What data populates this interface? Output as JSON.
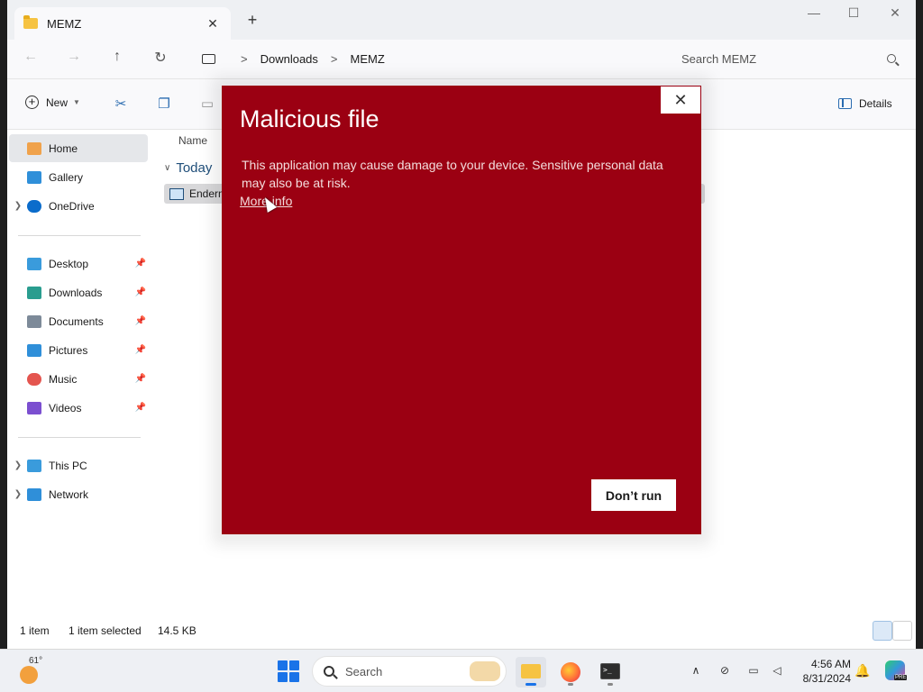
{
  "window": {
    "tab_title": "MEMZ",
    "tab_close": "✕",
    "new_tab": "+",
    "controls": {
      "minimize": "—",
      "maximize": "☐",
      "close": "✕"
    }
  },
  "address": {
    "breadcrumb": [
      "Downloads",
      "MEMZ"
    ],
    "separator": ">",
    "search_placeholder": "Search MEMZ"
  },
  "toolbar": {
    "new_label": "New",
    "details_label": "Details",
    "icons": [
      "cut-icon",
      "copy-icon",
      "paste-icon"
    ]
  },
  "sidebar": {
    "items": [
      {
        "label": "Home",
        "icon": "home-icon",
        "color": "#f0a24b"
      },
      {
        "label": "Gallery",
        "icon": "gallery-icon",
        "color": "#2f8fd9"
      },
      {
        "label": "OneDrive",
        "icon": "onedrive-icon",
        "color": "#0b6ccb"
      },
      {
        "label": "Desktop",
        "icon": "desktop-icon",
        "color": "#3a9bdc"
      },
      {
        "label": "Downloads",
        "icon": "downloads-icon",
        "color": "#2a9d8f"
      },
      {
        "label": "Documents",
        "icon": "documents-icon",
        "color": "#7d8a99"
      },
      {
        "label": "Pictures",
        "icon": "pictures-icon",
        "color": "#2f8fd9"
      },
      {
        "label": "Music",
        "icon": "music-icon",
        "color": "#e4554f"
      },
      {
        "label": "Videos",
        "icon": "videos-icon",
        "color": "#7b4fd0"
      },
      {
        "label": "This PC",
        "icon": "this-pc-icon",
        "color": "#3a9bdc"
      },
      {
        "label": "Network",
        "icon": "network-icon",
        "color": "#2f8fd9"
      }
    ]
  },
  "content": {
    "column_name": "Name",
    "group_label": "Today",
    "files": [
      {
        "name": "Enderm"
      }
    ]
  },
  "status": {
    "item_count": "1 item",
    "selection": "1 item selected",
    "size": "14.5 KB"
  },
  "dialog": {
    "title": "Malicious file",
    "body": "This application may cause damage to your device. Sensitive personal data may also be at risk.",
    "link": "More info",
    "button": "Don’t run",
    "close": "✕",
    "background_color": "#9b0012"
  },
  "taskbar": {
    "weather_temp": "61°",
    "search_label": "Search",
    "time": "4:56 AM",
    "date": "8/31/2024",
    "terminal_glyph": ">_"
  }
}
